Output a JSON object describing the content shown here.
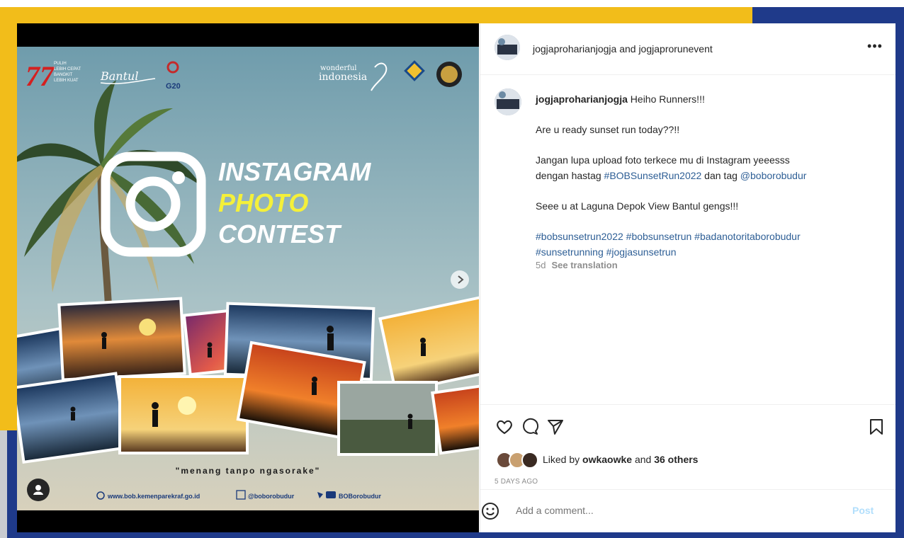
{
  "header": {
    "accounts": "jogjaproharianjogja and jogjaprorunevent",
    "more_label": "•••"
  },
  "caption": {
    "username": "jogjaproharianjogja",
    "line1": "Heiho Runners!!!",
    "line2": "Are u ready sunset run today??!!",
    "line3a": "Jangan lupa upload foto terkece mu di Instagram yeeesss",
    "line3b_prefix": "dengan hastag ",
    "hashtag_main": "#BOBSunsetRun2022",
    "line3b_mid": " dan tag ",
    "mention": "@boborobudur",
    "line4": "Seee u at Laguna Depok View Bantul gengs!!!",
    "hashtags1": "#bobsunsetrun2022 #bobsunsetrun #badanotoritaborobudur",
    "hashtags2": "#sunsetrunning #jogjasunsetrun"
  },
  "meta": {
    "age": "5d",
    "translate": "See translation"
  },
  "likes": {
    "prefix": "Liked by ",
    "user": "owkaowke",
    "mid": " and ",
    "others": "36 others"
  },
  "posted_ago": "5 DAYS AGO",
  "comment": {
    "placeholder": "Add a comment...",
    "post_label": "Post"
  },
  "poster": {
    "logo_left1": "PULIH",
    "logo_left2": "LEBIH CEPAT",
    "logo_left3": "BANGKIT",
    "logo_left4": "LEBIH KUAT",
    "brand_script": "Bantul",
    "g20": "G20",
    "wonderful": "wonderful",
    "indonesia": "indonesia",
    "title1": "INSTAGRAM",
    "title2": "PHOTO",
    "title3": "CONTEST",
    "slogan": "\"menang tanpo ngasorake\"",
    "website": "www.bob.kemenparekraf.go.id",
    "ig_handle": "@boborobudur",
    "yt_handle": "BOBorobudur"
  },
  "colors": {
    "accent_yellow": "#f2bd1a",
    "navy": "#1f3a8a",
    "link": "#2d5e95",
    "poster_yellow": "#f4f03a"
  }
}
